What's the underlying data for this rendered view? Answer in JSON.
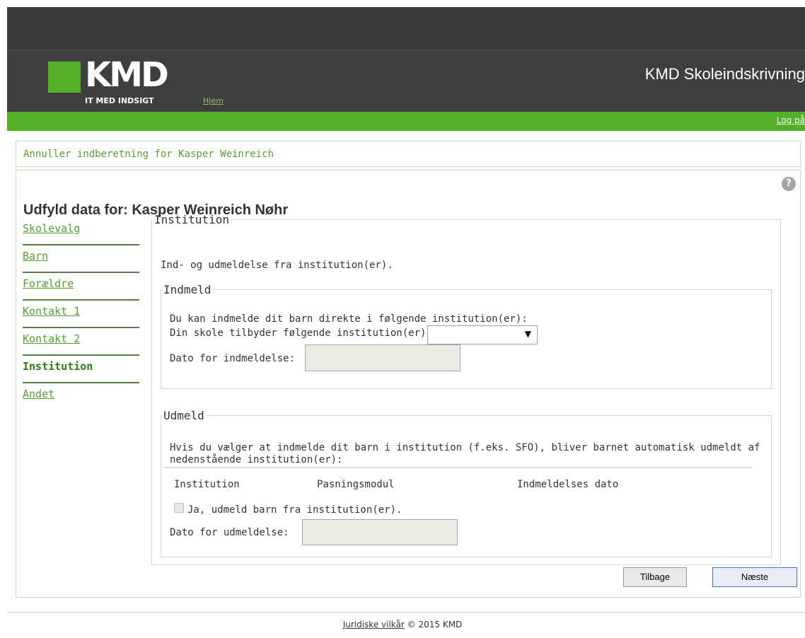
{
  "header": {
    "logo_text": "KMD",
    "logo_sub": "IT MED INDSIGT",
    "home_link": "Hjem",
    "app_title": "KMD Skoleindskrivning",
    "login_link": "Log på"
  },
  "cancel": {
    "link": "Annuller indberetning for Kasper Weinreich"
  },
  "main": {
    "title": "Udfyld data for: Kasper Weinreich Nøhr",
    "help_icon": "?"
  },
  "nav": {
    "items": [
      {
        "label": "Skolevalg"
      },
      {
        "label": "Barn"
      },
      {
        "label": "Forældre"
      },
      {
        "label": "Kontakt 1"
      },
      {
        "label": "Kontakt 2"
      },
      {
        "label": "Institution"
      },
      {
        "label": "Andet"
      }
    ],
    "active": "Institution"
  },
  "institution": {
    "legend": "Institution",
    "intro": "Ind- og udmeldelse fra institution(er).",
    "indmeld": {
      "legend": "Indmeld",
      "line1": "Du kan indmelde dit barn direkte i følgende institution(er):",
      "select_label": "Din skole tilbyder følgende institution(er):",
      "select_value": "",
      "date_label": "Dato for indmeldelse:",
      "date_value": ""
    },
    "udmeld": {
      "legend": "Udmeld",
      "text_line1": "Hvis du vælger at indmelde dit barn i institution (f.eks. SFO), bliver barnet automatisk udmeldt af",
      "text_line2": "nedenstående institution(er):",
      "columns": [
        "Institution",
        "Pasningsmodul",
        "Indmeldelses dato"
      ],
      "checkbox_label": "Ja, udmeld barn fra institution(er).",
      "checkbox_checked": false,
      "date_label": "Dato for udmeldelse:",
      "date_value": ""
    }
  },
  "buttons": {
    "back": "Tilbage",
    "next": "Næste"
  },
  "footer": {
    "link": "Juridiske vilkår",
    "text": "© 2015 KMD"
  },
  "colors": {
    "brand_green": "#55b027",
    "header_bg": "#3f3f3f",
    "link_green": "#55a030"
  }
}
